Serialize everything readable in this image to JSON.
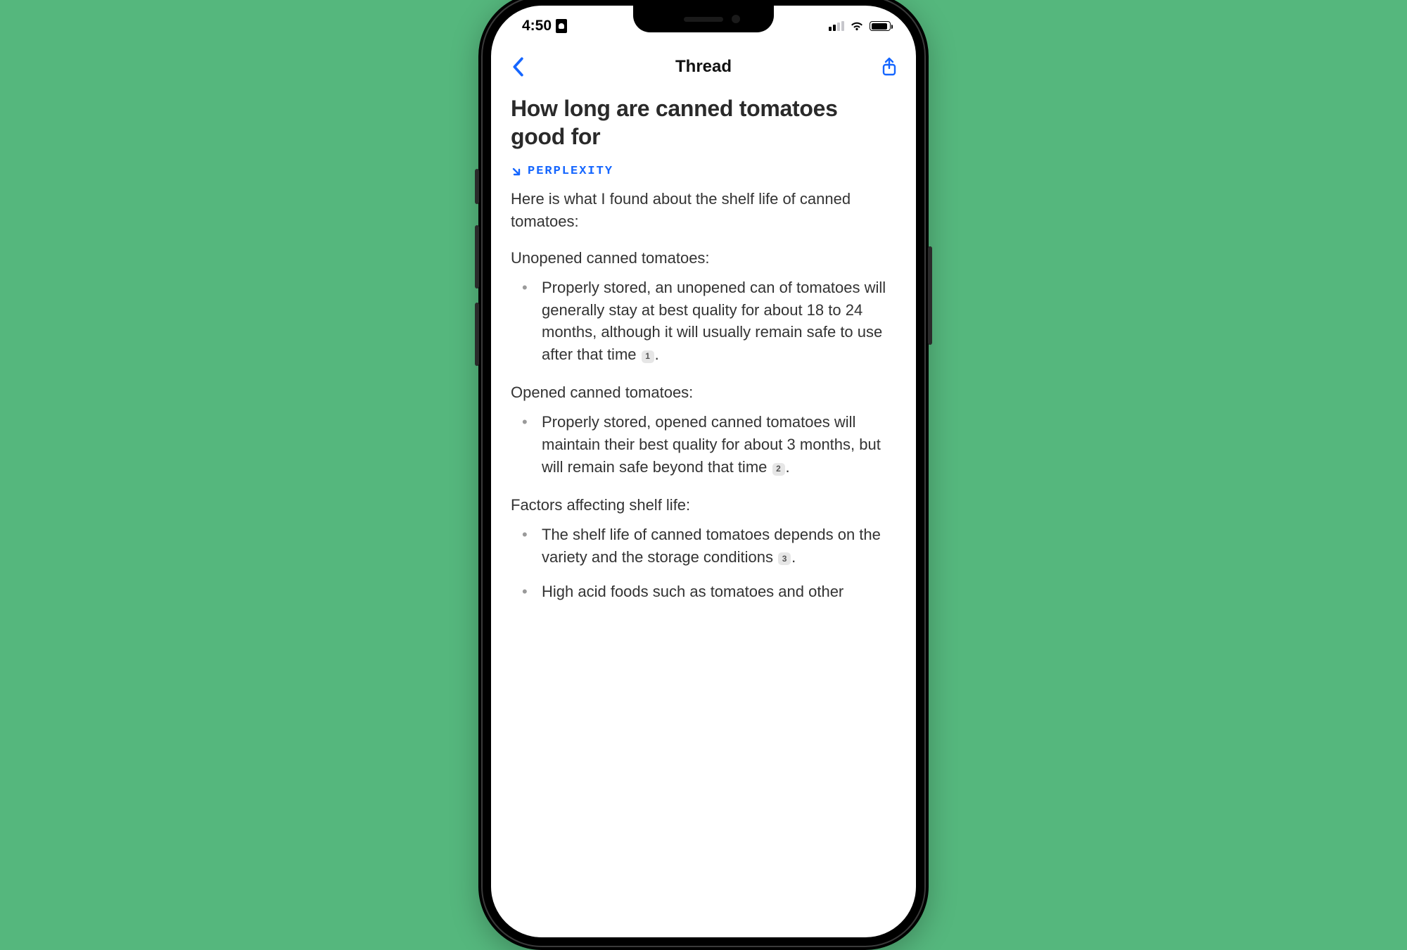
{
  "status": {
    "time": "4:50",
    "signal_active_bars": 2,
    "signal_total_bars": 4
  },
  "nav": {
    "title": "Thread"
  },
  "thread": {
    "question": "How long are canned tomatoes good for",
    "source_label": "PERPLEXITY",
    "intro": "Here is what I found about the shelf life of canned tomatoes:",
    "sections": [
      {
        "heading": "Unopened canned tomatoes:",
        "items": [
          {
            "text": "Properly stored, an unopened can of tomatoes will generally stay at best quality for about 18 to 24 months, although it will usually remain safe to use after that time",
            "cite": "1",
            "suffix": "."
          }
        ]
      },
      {
        "heading": "Opened canned tomatoes:",
        "items": [
          {
            "text": "Properly stored, opened canned tomatoes will maintain their best quality for about 3 months, but will remain safe beyond that time",
            "cite": "2",
            "suffix": "."
          }
        ]
      },
      {
        "heading": "Factors affecting shelf life:",
        "items": [
          {
            "text": "The shelf life of canned tomatoes depends on the variety and the storage conditions",
            "cite": "3",
            "suffix": "."
          },
          {
            "text": "High acid foods such as tomatoes and other",
            "cite": null,
            "suffix": ""
          }
        ]
      }
    ]
  }
}
